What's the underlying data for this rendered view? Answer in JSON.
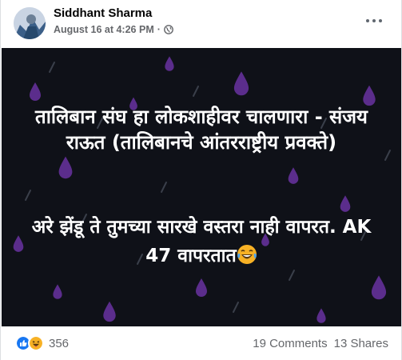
{
  "post": {
    "author": "Siddhant Sharma",
    "timestamp": "August 16 at 4:26 PM",
    "separator": "·",
    "privacy_icon": "globe-icon",
    "more_icon": "more-options-icon"
  },
  "image": {
    "line1": "तालिबान संघ हा लोकशाहीवर चालणारा - संजय राऊत (तालिबानचे आंतरराष्ट्रीय प्रवक्ते)",
    "line2": "अरे झेंडू ते तुमच्या सारखे वस्तरा नाही वापरत. AK 47 वापरतात",
    "emoji": "laughing-tears-emoji",
    "background_color": "#0f1118",
    "drop_color": "#5b2d8c"
  },
  "footer": {
    "reaction_icons": [
      "like-icon",
      "haha-icon"
    ],
    "reaction_count": "356",
    "comments": "19 Comments",
    "shares": "13 Shares"
  },
  "colors": {
    "like_blue": "#1877f2",
    "haha_yellow": "#f7b125",
    "text_secondary": "#65676b"
  }
}
